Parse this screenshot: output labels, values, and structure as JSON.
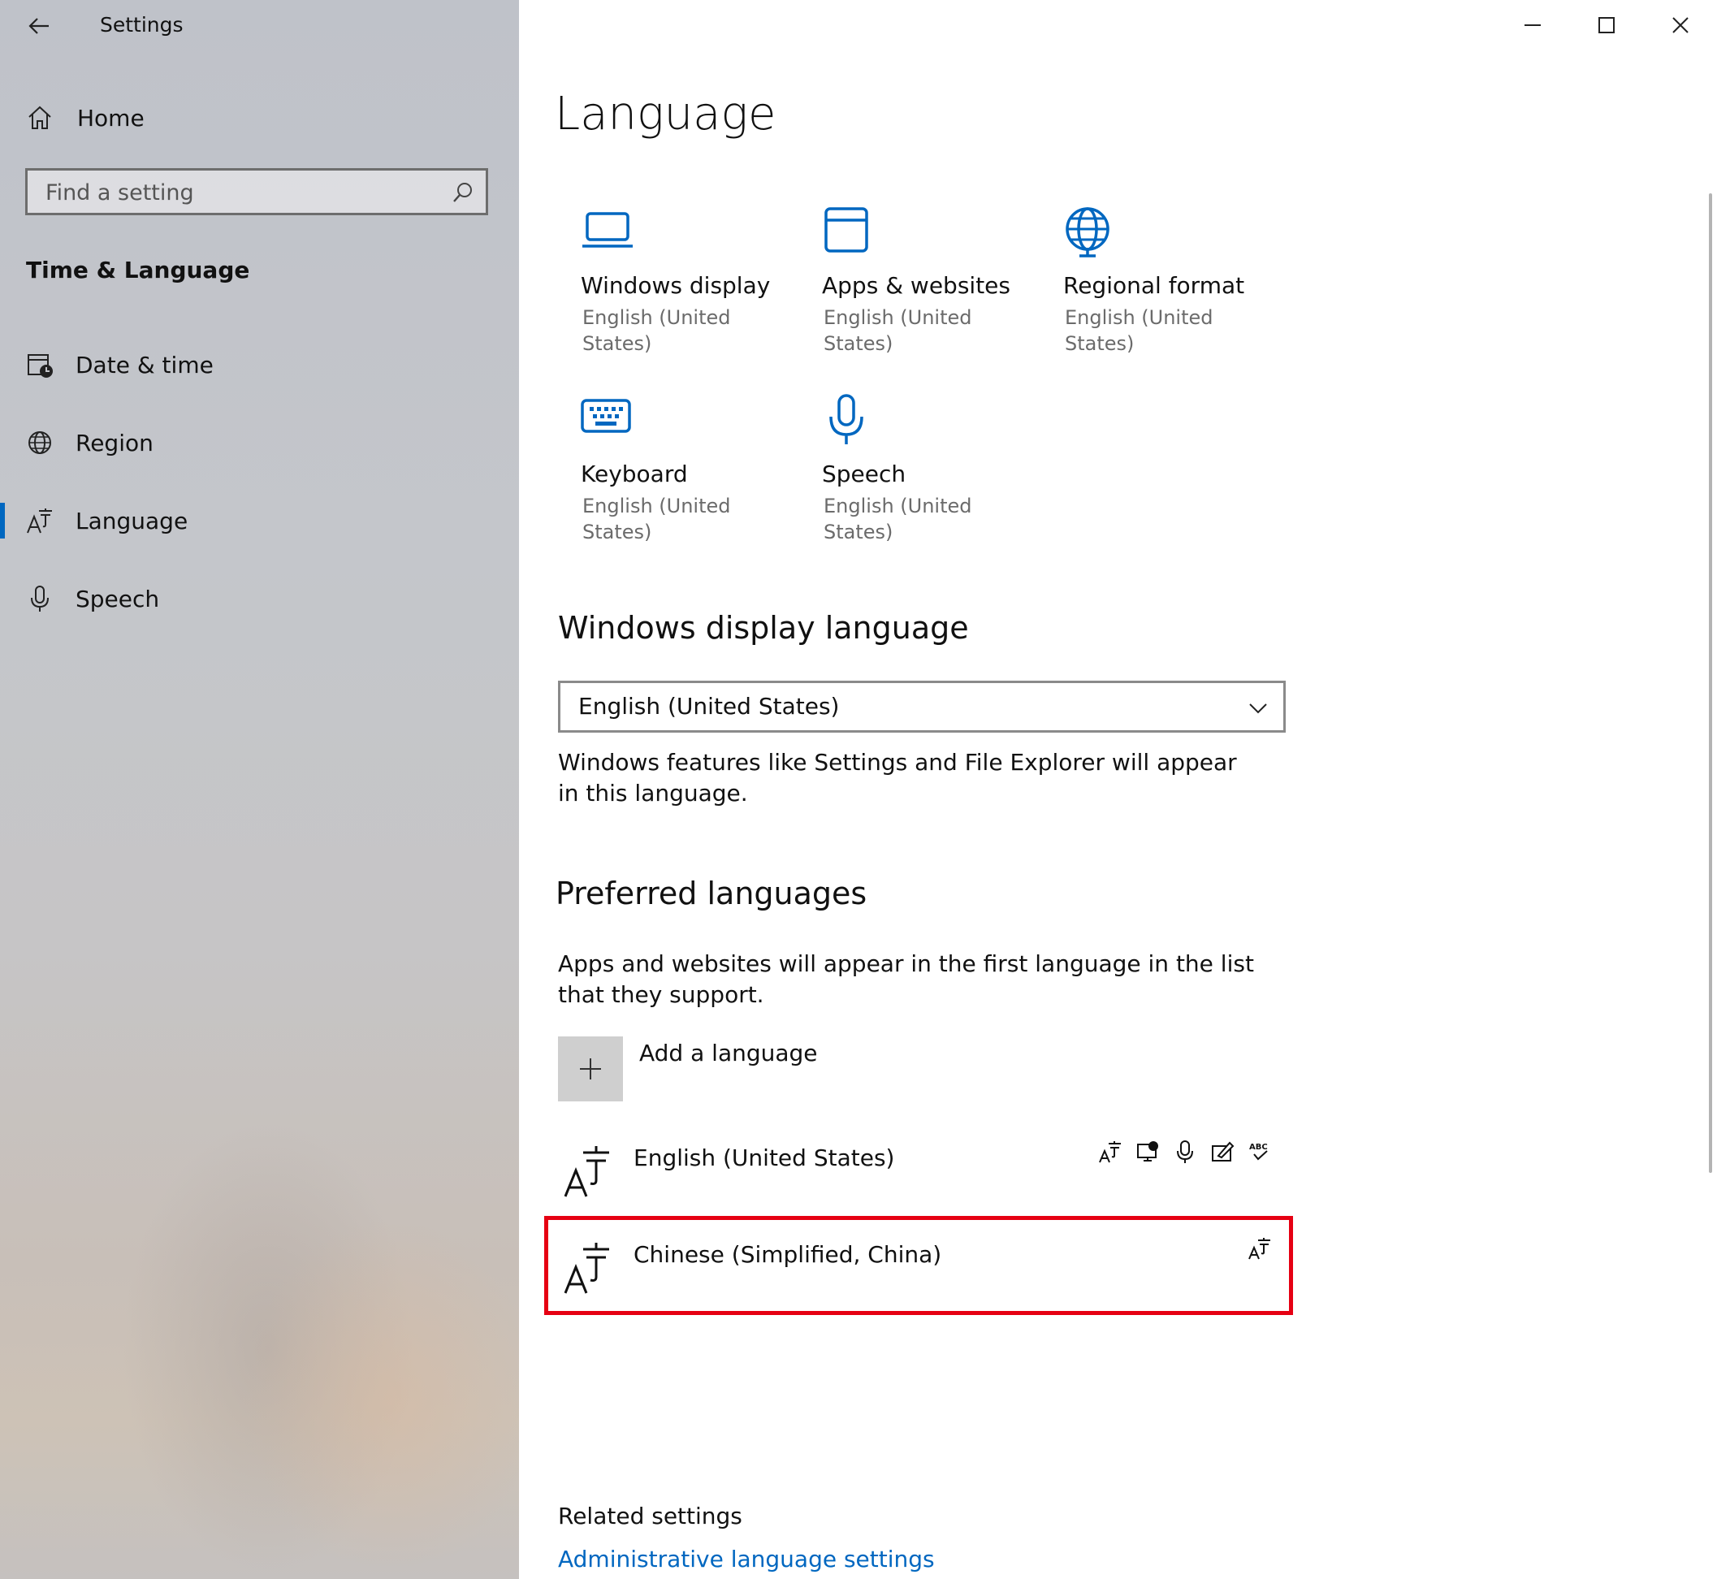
{
  "app": {
    "title": "Settings"
  },
  "sidebar": {
    "home_label": "Home",
    "search_placeholder": "Find a setting",
    "section_title": "Time & Language",
    "items": [
      {
        "label": "Date & time",
        "icon": "calendar-clock-icon"
      },
      {
        "label": "Region",
        "icon": "globe-icon"
      },
      {
        "label": "Language",
        "icon": "language-icon",
        "active": true
      },
      {
        "label": "Speech",
        "icon": "microphone-icon"
      }
    ]
  },
  "main": {
    "title": "Language",
    "tiles": [
      {
        "title": "Windows display",
        "sub": "English (United States)",
        "icon": "laptop-icon"
      },
      {
        "title": "Apps & websites",
        "sub": "English (United States)",
        "icon": "window-icon"
      },
      {
        "title": "Regional format",
        "sub": "English (United States)",
        "icon": "globe-icon"
      },
      {
        "title": "Keyboard",
        "sub": "English (United States)",
        "icon": "keyboard-icon"
      },
      {
        "title": "Speech",
        "sub": "English (United States)",
        "icon": "microphone-icon"
      }
    ],
    "display_language": {
      "heading": "Windows display language",
      "selected": "English (United States)",
      "description": "Windows features like Settings and File Explorer will appear in this language."
    },
    "preferred": {
      "heading": "Preferred languages",
      "description": "Apps and websites will appear in the first language in the list that they support.",
      "add_label": "Add a language",
      "languages": [
        {
          "name": "English (United States)"
        },
        {
          "name": "Chinese (Simplified, China)"
        }
      ]
    },
    "related": {
      "heading": "Related settings",
      "link": "Administrative language settings"
    }
  },
  "colors": {
    "accent": "#0067c0",
    "highlight": "#e60012"
  }
}
